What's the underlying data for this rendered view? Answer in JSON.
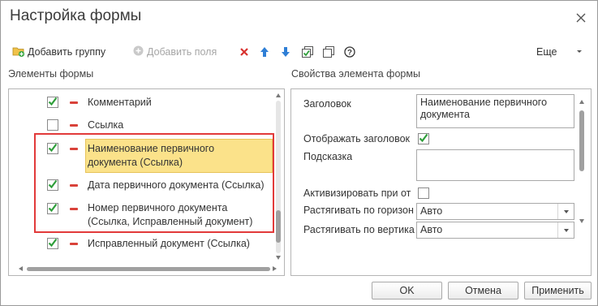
{
  "window": {
    "title": "Настройка формы"
  },
  "toolbar": {
    "add_group": "Добавить группу",
    "add_fields": "Добавить поля",
    "more": "Еще"
  },
  "left_panel": {
    "title": "Элементы формы",
    "rows": [
      {
        "label": "Комментарий",
        "checked": true
      },
      {
        "label": "Ссылка",
        "checked": false
      },
      {
        "label": "Наименование первичного документа (Ссылка)",
        "line1": "Наименование первичного",
        "line2": "документа (Ссылка)",
        "checked": true,
        "selected": true
      },
      {
        "label": "Дата первичного документа (Ссылка)",
        "checked": true
      },
      {
        "label": "Номер первичного документа (Ссылка, Исправленный документ)",
        "line1": "Номер первичного документа",
        "line2": "(Ссылка, Исправленный документ)",
        "checked": true
      },
      {
        "label": "Исправленный документ (Ссылка)",
        "checked": true
      }
    ]
  },
  "right_panel": {
    "title": "Свойства элемента формы",
    "props": {
      "caption_label": "Заголовок",
      "caption_value": "Наименование первичного документа",
      "show_caption_label": "Отображать заголовок",
      "show_caption_checked": true,
      "hint_label": "Подсказка",
      "hint_value": "",
      "activate_label": "Активизировать при от",
      "activate_checked": false,
      "stretch_h_label": "Растягивать по горизон",
      "stretch_h_value": "Авто",
      "stretch_v_label": "Растягивать по вертика",
      "stretch_v_value": "Авто"
    }
  },
  "footer": {
    "ok": "OK",
    "cancel": "Отмена",
    "apply": "Применить"
  },
  "colors": {
    "check": "#2e9e3a",
    "minus": "#d9423a",
    "selection": "#fbe28a",
    "highlight_border": "#e23a3a"
  }
}
